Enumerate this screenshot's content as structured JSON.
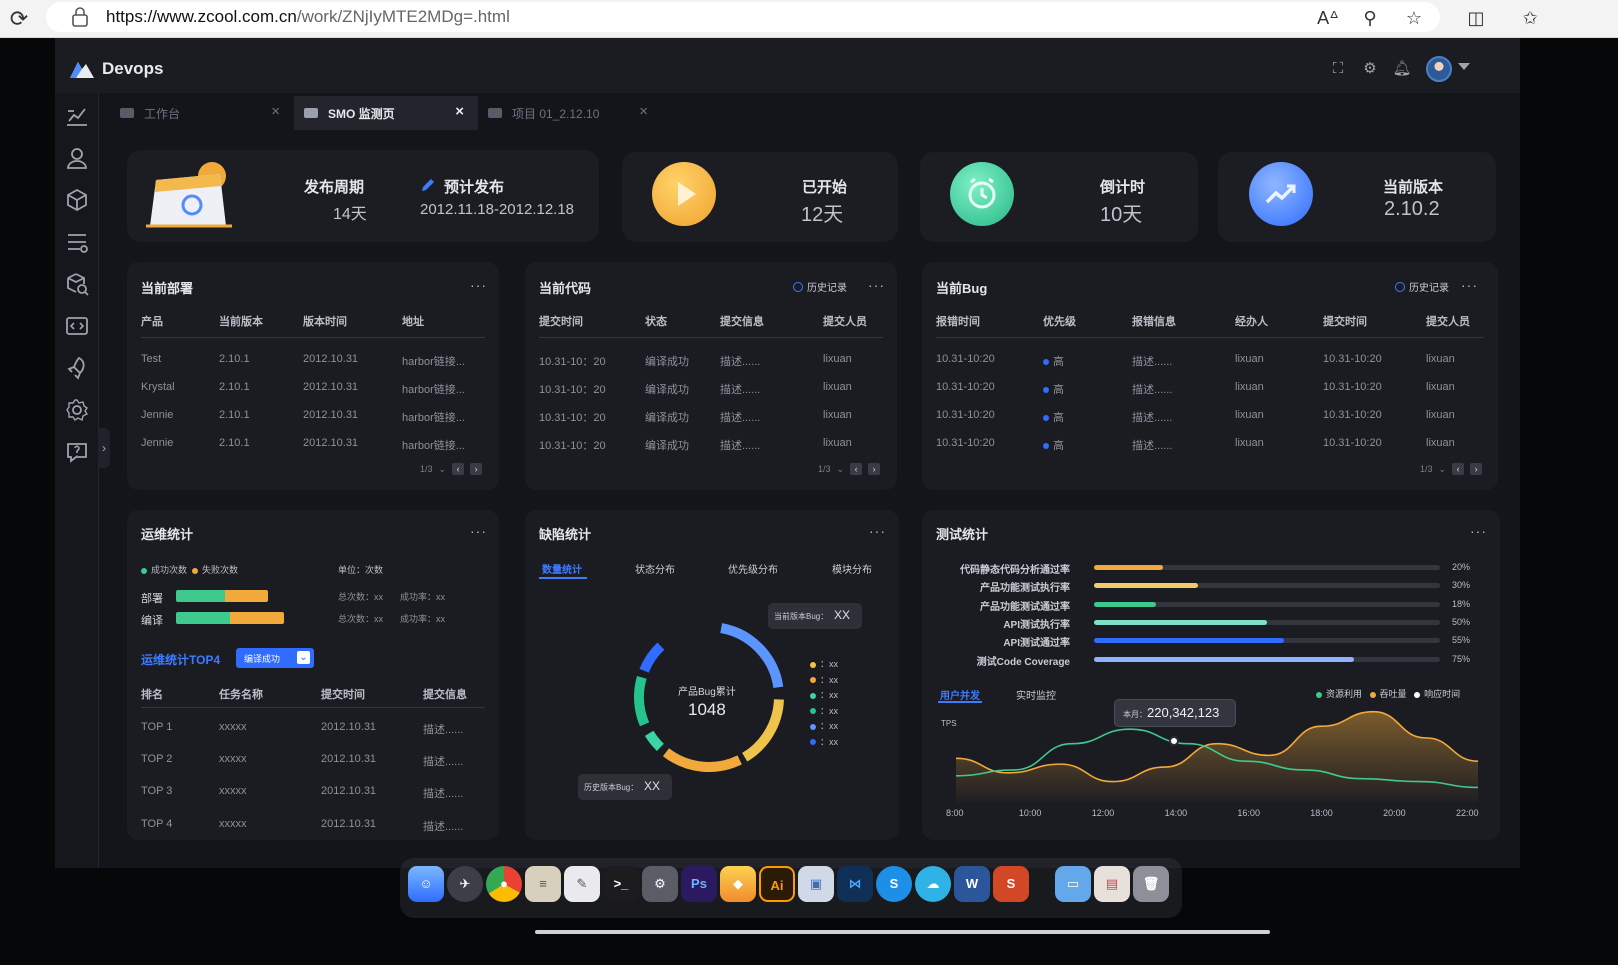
{
  "browser": {
    "url_host": "https://www.zcool.com.cn",
    "url_path": "/work/ZNjIyMTE2MDg=.html"
  },
  "app": {
    "logo_text": "Devops",
    "tabs": [
      {
        "label": "工作台",
        "active": false
      },
      {
        "label": "SMO 监测页",
        "active": true
      },
      {
        "label": "项目 01_2.12.10",
        "active": false
      }
    ]
  },
  "stats": {
    "cycle_label": "发布周期",
    "cycle_value": "14天",
    "plan_label": "预计发布",
    "plan_value": "2012.11.18-2012.12.18",
    "started_label": "已开始",
    "started_value": "12天",
    "countdown_label": "倒计时",
    "countdown_value": "10天",
    "version_label": "当前版本",
    "version_value": "2.10.2"
  },
  "deploy": {
    "title": "当前部署",
    "headers": [
      "产品",
      "当前版本",
      "版本时间",
      "地址"
    ],
    "rows": [
      [
        "Test",
        "2.10.1",
        "2012.10.31",
        "harbor链接..."
      ],
      [
        "Krystal",
        "2.10.1",
        "2012.10.31",
        "harbor链接..."
      ],
      [
        "Jennie",
        "2.10.1",
        "2012.10.31",
        "harbor链接..."
      ],
      [
        "Jennie",
        "2.10.1",
        "2012.10.31",
        "harbor链接..."
      ]
    ],
    "pager": "1/3"
  },
  "code": {
    "title": "当前代码",
    "history": "历史记录",
    "headers": [
      "提交时间",
      "状态",
      "提交信息",
      "提交人员"
    ],
    "rows": [
      [
        "10.31-10：20",
        "编译成功",
        "描述......",
        "lixuan"
      ],
      [
        "10.31-10：20",
        "编译成功",
        "描述......",
        "lixuan"
      ],
      [
        "10.31-10：20",
        "编译成功",
        "描述......",
        "lixuan"
      ],
      [
        "10.31-10：20",
        "编译成功",
        "描述......",
        "lixuan"
      ]
    ],
    "pager": "1/3"
  },
  "bug": {
    "title": "当前Bug",
    "history": "历史记录",
    "headers": [
      "报错时间",
      "优先级",
      "报错信息",
      "经办人",
      "提交时间",
      "提交人员"
    ],
    "rows": [
      [
        "10.31-10:20",
        "高",
        "描述......",
        "lixuan",
        "10.31-10:20",
        "lixuan"
      ],
      [
        "10.31-10:20",
        "高",
        "描述......",
        "lixuan",
        "10.31-10:20",
        "lixuan"
      ],
      [
        "10.31-10:20",
        "高",
        "描述......",
        "lixuan",
        "10.31-10:20",
        "lixuan"
      ],
      [
        "10.31-10:20",
        "高",
        "描述......",
        "lixuan",
        "10.31-10:20",
        "lixuan"
      ]
    ],
    "pager": "1/3"
  },
  "ops": {
    "title": "运维统计",
    "legend_success": "成功次数",
    "legend_fail": "失败次数",
    "unit": "单位：次数",
    "bars": [
      {
        "label": "部署",
        "success": 0.45,
        "fail": 0.4,
        "total": "总次数：xx",
        "rate": "成功率：xx"
      },
      {
        "label": "编译",
        "success": 0.5,
        "fail": 0.5,
        "total": "总次数：xx",
        "rate": "成功率：xx"
      }
    ],
    "top_title": "运维统计TOP4",
    "top_filter": "编译成功",
    "headers": [
      "排名",
      "任务名称",
      "提交时间",
      "提交信息"
    ],
    "rows": [
      [
        "TOP 1",
        "xxxxx",
        "2012.10.31",
        "描述......"
      ],
      [
        "TOP 2",
        "xxxxx",
        "2012.10.31",
        "描述......"
      ],
      [
        "TOP 3",
        "xxxxx",
        "2012.10.31",
        "描述......"
      ],
      [
        "TOP 4",
        "xxxxx",
        "2012.10.31",
        "描述......"
      ]
    ]
  },
  "defect": {
    "title": "缺陷统计",
    "tabs": [
      "数量统计",
      "状态分布",
      "优先级分布",
      "模块分布"
    ],
    "center_label": "产品Bug累计",
    "center_value": "1048",
    "current_bug": "当前版本Bug：",
    "current_bug_value": "XX",
    "history_bug": "历史版本Bug：",
    "history_bug_value": "XX",
    "legend": [
      {
        "color": "#f0c44c",
        "text": "：xx"
      },
      {
        "color": "#f0a93a",
        "text": "：xx"
      },
      {
        "color": "#3ed2a8",
        "text": "：xx"
      },
      {
        "color": "#25c38e",
        "text": "：xx"
      },
      {
        "color": "#5b95ff",
        "text": "：xx"
      },
      {
        "color": "#2f6cff",
        "text": "：xx"
      }
    ]
  },
  "test": {
    "title": "测试统计",
    "rows": [
      {
        "label": "代码静态代码分析通过率",
        "pct": "20%",
        "value": 0.2,
        "color": "#f0a93a"
      },
      {
        "label": "产品功能测试执行率",
        "pct": "30%",
        "value": 0.3,
        "color": "#f3c96a"
      },
      {
        "label": "产品功能测试通过率",
        "pct": "18%",
        "value": 0.18,
        "color": "#3ec98f"
      },
      {
        "label": "API测试执行率",
        "pct": "50%",
        "value": 0.5,
        "color": "#7fe0c9"
      },
      {
        "label": "API测试通过率",
        "pct": "55%",
        "value": 0.55,
        "color": "#2f6cff"
      },
      {
        "label": "测试Code Coverage",
        "pct": "75%",
        "value": 0.75,
        "color": "#8fb2ff"
      }
    ],
    "sub_tabs": [
      "用户并发",
      "实时监控"
    ],
    "legend": [
      "资源利用",
      "吞吐量",
      "响应时间"
    ],
    "tooltip_label": "本月：",
    "tooltip_value": "220,342,123",
    "y_label": "TPS"
  },
  "chart_data": {
    "type": "area",
    "x": [
      "8:00",
      "10:00",
      "12:00",
      "14:00",
      "16:00",
      "18:00",
      "20:00",
      "22:00"
    ],
    "series": [
      {
        "name": "资源利用",
        "color": "#3ec98f",
        "values": [
          18,
          22,
          40,
          50,
          40,
          28,
          22,
          16,
          14,
          10
        ]
      },
      {
        "name": "吞吐量",
        "color": "#f0a93a",
        "values": [
          30,
          20,
          26,
          14,
          24,
          40,
          32,
          52,
          62,
          44,
          28
        ]
      }
    ]
  }
}
